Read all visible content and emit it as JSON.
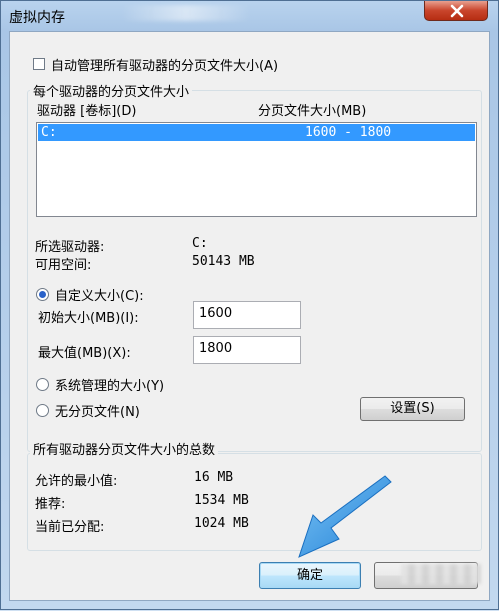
{
  "window": {
    "title": "虚拟内存"
  },
  "auto_manage": {
    "label": "自动管理所有驱动器的分页文件大小(A)",
    "checked": false
  },
  "per_drive": {
    "legend": "每个驱动器的分页文件大小",
    "header_drive": "驱动器 [卷标](D)",
    "header_size": "分页文件大小(MB)",
    "drives": [
      {
        "drive": "C:",
        "size": "1600 - 1800"
      }
    ],
    "selected_drive_label": "所选驱动器:",
    "selected_drive_value": "C:",
    "free_space_label": "可用空间:",
    "free_space_value": "50143 MB",
    "custom_size_label": "自定义大小(C):",
    "initial_size_label": "初始大小(MB)(I):",
    "initial_size_value": "1600",
    "max_size_label": "最大值(MB)(X):",
    "max_size_value": "1800",
    "system_managed_label": "系统管理的大小(Y)",
    "no_paging_label": "无分页文件(N)",
    "selected_option": "custom",
    "set_button": "设置(S)"
  },
  "totals": {
    "legend": "所有驱动器分页文件大小的总数",
    "min_label": "允许的最小值:",
    "min_value": "16 MB",
    "recommended_label": "推荐:",
    "recommended_value": "1534 MB",
    "allocated_label": "当前已分配:",
    "allocated_value": "1024 MB"
  },
  "buttons": {
    "ok": "确定"
  },
  "colors": {
    "accent_arrow": "#2f8fe0",
    "selection": "#3399ff"
  }
}
